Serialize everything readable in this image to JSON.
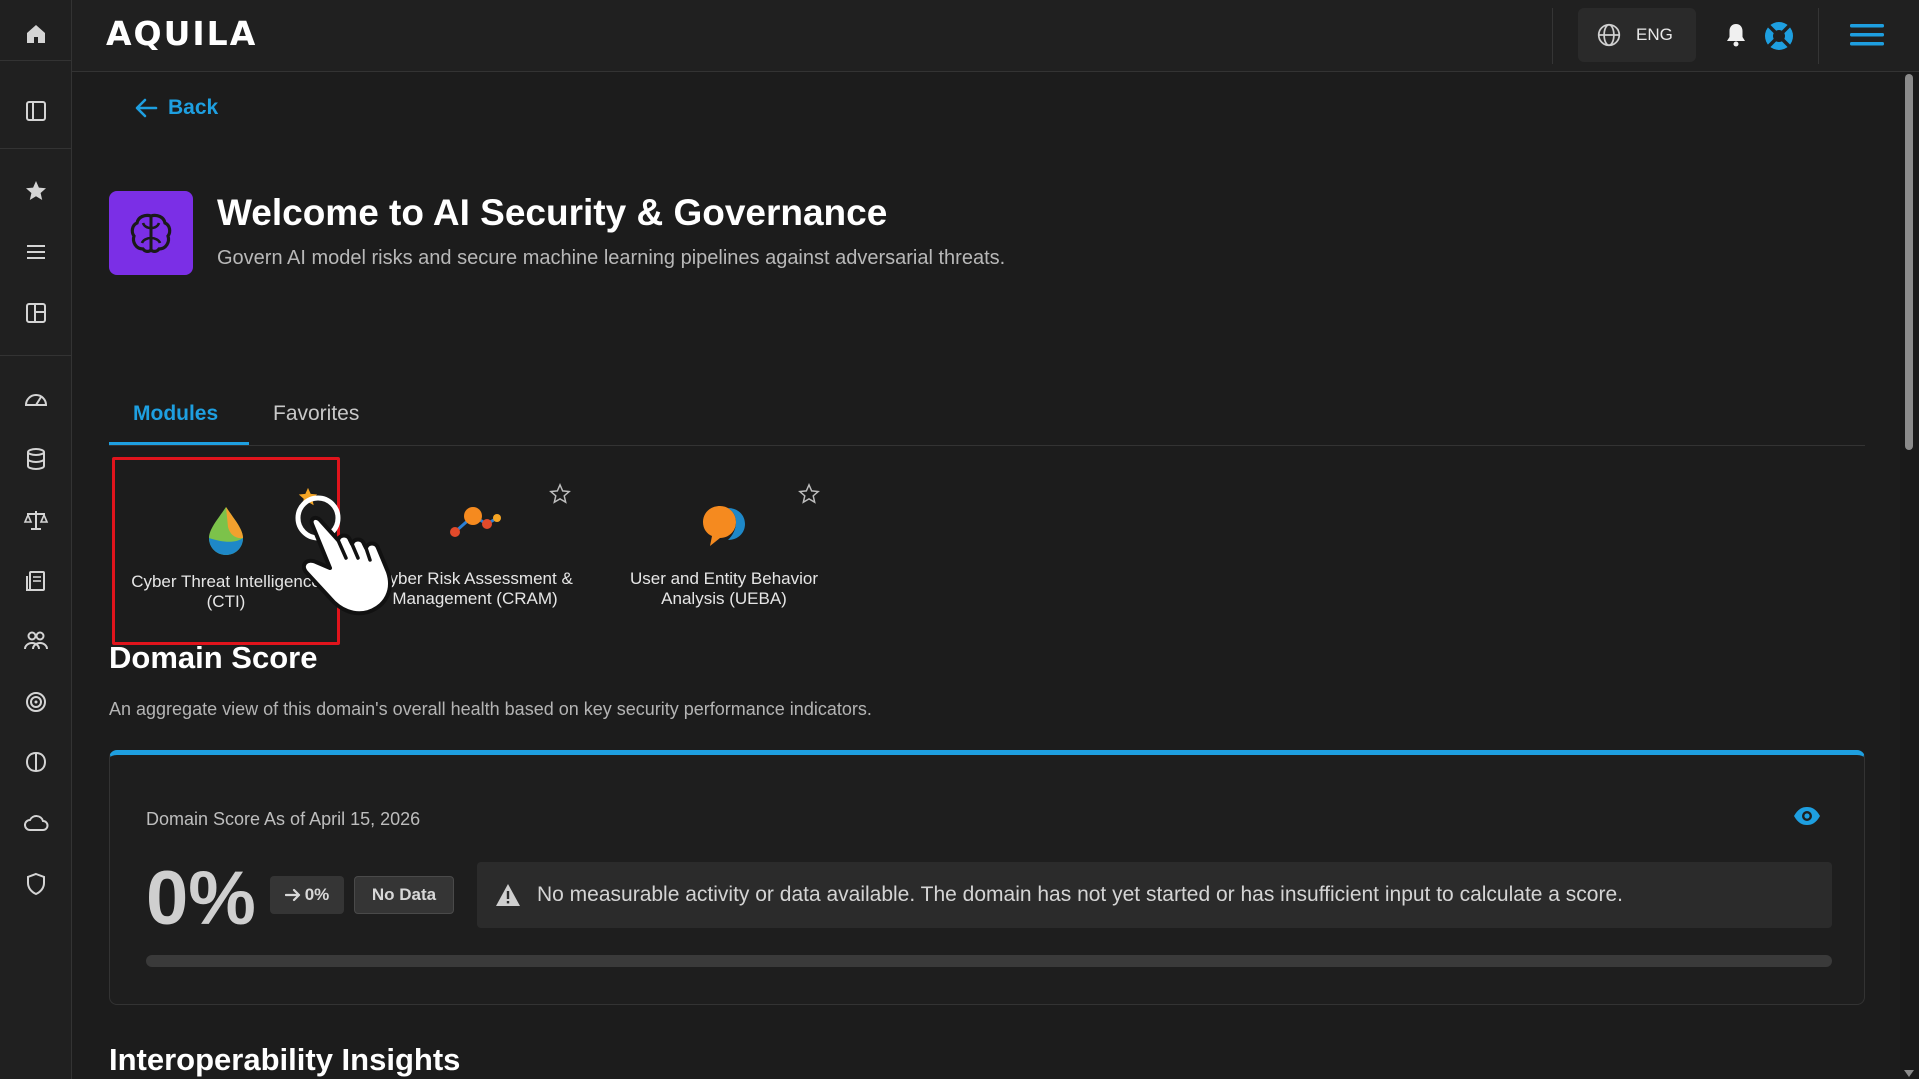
{
  "app": {
    "name": "AQUILA",
    "language": "ENG"
  },
  "rail": {
    "icons": [
      "home-icon",
      "sidebar-panel-icon",
      "star-icon",
      "list-icon",
      "layout-icon",
      "gauge-icon",
      "database-icon",
      "scales-icon",
      "document-icon",
      "users-icon",
      "target-icon",
      "brain-icon",
      "cloud-icon",
      "shield-icon"
    ]
  },
  "nav": {
    "back_label": "Back"
  },
  "page": {
    "title": "Welcome to AI Security & Governance",
    "subtitle": "Govern AI model risks and secure machine learning pipelines against adversarial threats.",
    "icon": "brain-icon",
    "accent": "#7b2fe6"
  },
  "tabs": [
    {
      "label": "Modules",
      "active": true
    },
    {
      "label": "Favorites",
      "active": false
    }
  ],
  "modules": [
    {
      "label": "Cyber Threat Intelligence (CTI)",
      "favorite": true,
      "icon": "cti-drop-icon"
    },
    {
      "label": "Cyber Risk Assessment & Management (CRAM)",
      "favorite": false,
      "icon": "cram-graph-icon"
    },
    {
      "label": "User and Entity Behavior Analysis (UEBA)",
      "favorite": false,
      "icon": "ueba-bubble-icon"
    }
  ],
  "domain_score": {
    "title": "Domain Score",
    "description": "An aggregate view of this domain's overall health based on key security performance indicators.",
    "as_of_label": "Domain Score As of April 15, 2026",
    "value": "0%",
    "trend": "0%",
    "status": "No Data",
    "message": "No measurable activity or data available. The domain has not yet started or has insufficient input to calculate a score.",
    "progress": 0
  },
  "next_section": {
    "title": "Interoperability Insights"
  },
  "colors": {
    "accent": "#1e9fe0",
    "star_active": "#f5a524",
    "highlight": "#e0141c"
  }
}
